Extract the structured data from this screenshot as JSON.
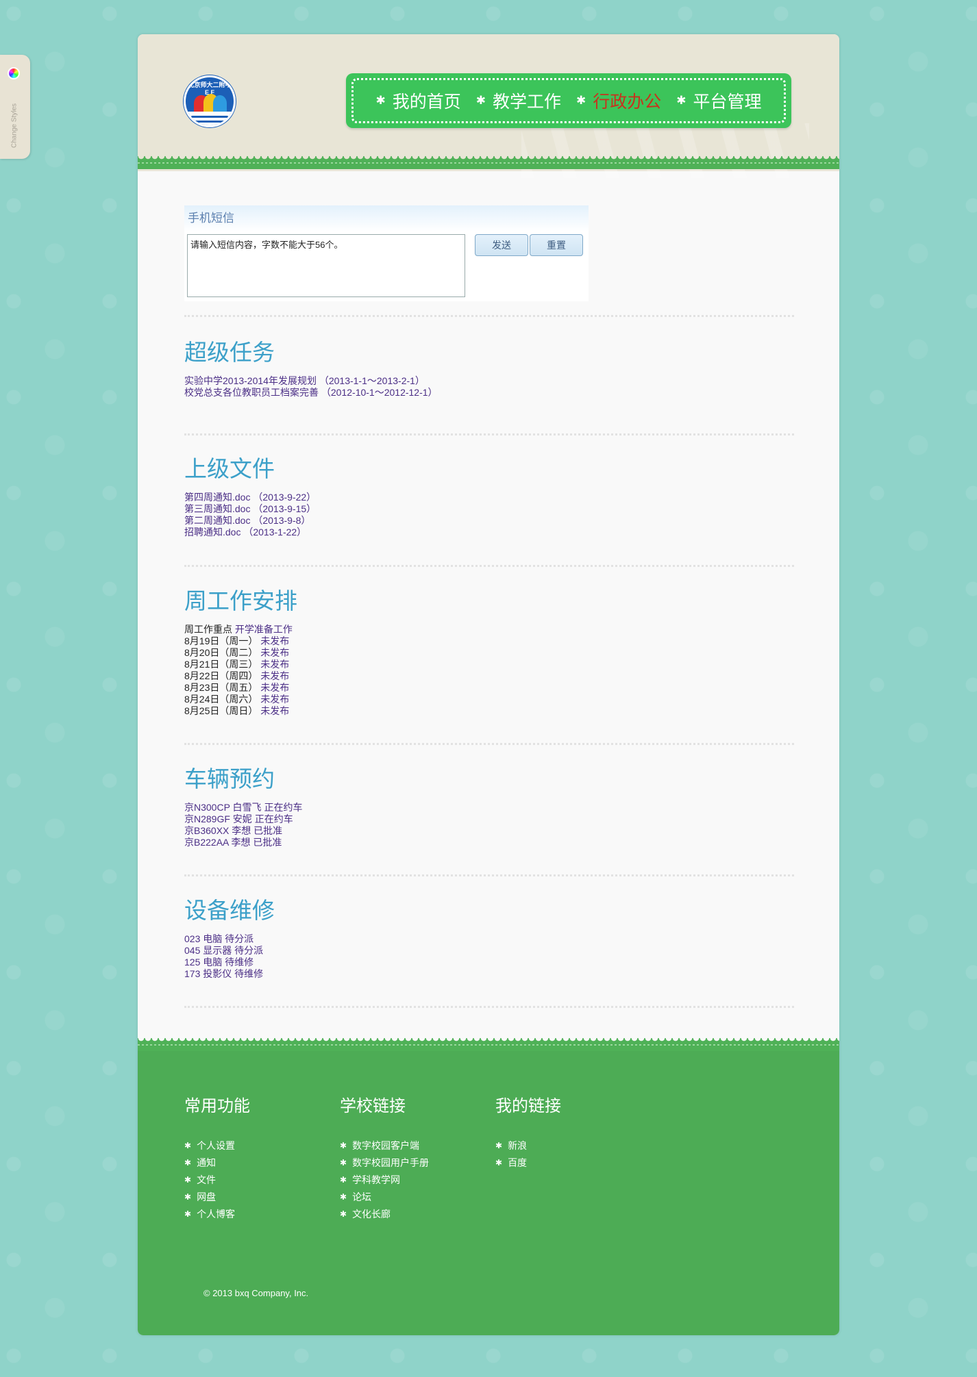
{
  "style_switcher": {
    "label": "Change Styles"
  },
  "logo": {
    "text": "北京师大二附中",
    "letters": "E F"
  },
  "nav": {
    "items": [
      {
        "label": "我的首页",
        "active": false
      },
      {
        "label": "教学工作",
        "active": false
      },
      {
        "label": "行政办公",
        "active": true
      },
      {
        "label": "平台管理",
        "active": false
      }
    ],
    "bullet": "✱"
  },
  "sms": {
    "title": "手机短信",
    "textarea_value": "请输入短信内容，字数不能大于56个。",
    "send_label": "发送",
    "reset_label": "重置"
  },
  "super_tasks": {
    "title": "超级任务",
    "items": [
      "实验中学2013-2014年发展规划 （2013-1-1～2013-2-1）",
      "校党总支各位教职员工档案完善 （2012-10-1～2012-12-1）"
    ]
  },
  "documents": {
    "title": "上级文件",
    "items": [
      "第四周通知.doc （2013-9-22）",
      "第三周通知.doc （2013-9-15）",
      "第二周通知.doc （2013-9-8）",
      "招聘通知.doc （2013-1-22）"
    ]
  },
  "weekly": {
    "title": "周工作安排",
    "focus_label": "周工作重点",
    "focus_value": "开学准备工作",
    "days": [
      {
        "day": "8月19日（周一）",
        "status": "未发布"
      },
      {
        "day": "8月20日（周二）",
        "status": "未发布"
      },
      {
        "day": "8月21日（周三）",
        "status": "未发布"
      },
      {
        "day": "8月22日（周四）",
        "status": "未发布"
      },
      {
        "day": "8月23日（周五）",
        "status": "未发布"
      },
      {
        "day": "8月24日（周六）",
        "status": "未发布"
      },
      {
        "day": "8月25日（周日）",
        "status": "未发布"
      }
    ]
  },
  "vehicles": {
    "title": "车辆预约",
    "items": [
      "京N300CP 白雪飞 正在约车",
      "京N289GF 安妮 正在约车",
      "京B360XX 李想 已批准",
      "京B222AA 李想 已批准"
    ]
  },
  "repairs": {
    "title": "设备维修",
    "items": [
      "023 电脑 待分派",
      "045 显示器 待分派",
      "125 电脑 待维修",
      "173 投影仪 待维修"
    ]
  },
  "footer": {
    "columns": [
      {
        "title": "常用功能",
        "items": [
          "个人设置",
          "通知",
          "文件",
          "网盘",
          "个人博客"
        ]
      },
      {
        "title": "学校链接",
        "items": [
          "数字校园客户端",
          "数字校园用户手册",
          "学科教学网",
          "论坛",
          "文化长廊"
        ]
      },
      {
        "title": "我的链接",
        "items": [
          "新浪",
          "百度"
        ]
      }
    ],
    "copyright": "© 2013 bxq Company, Inc."
  },
  "colors": {
    "background": "#8fd3c9",
    "nav_green": "#3cc45a",
    "active_red": "#c8321d",
    "heading_blue": "#3ca0c9",
    "footer_green": "#4dac55",
    "link_purple": "#4b2e86"
  }
}
